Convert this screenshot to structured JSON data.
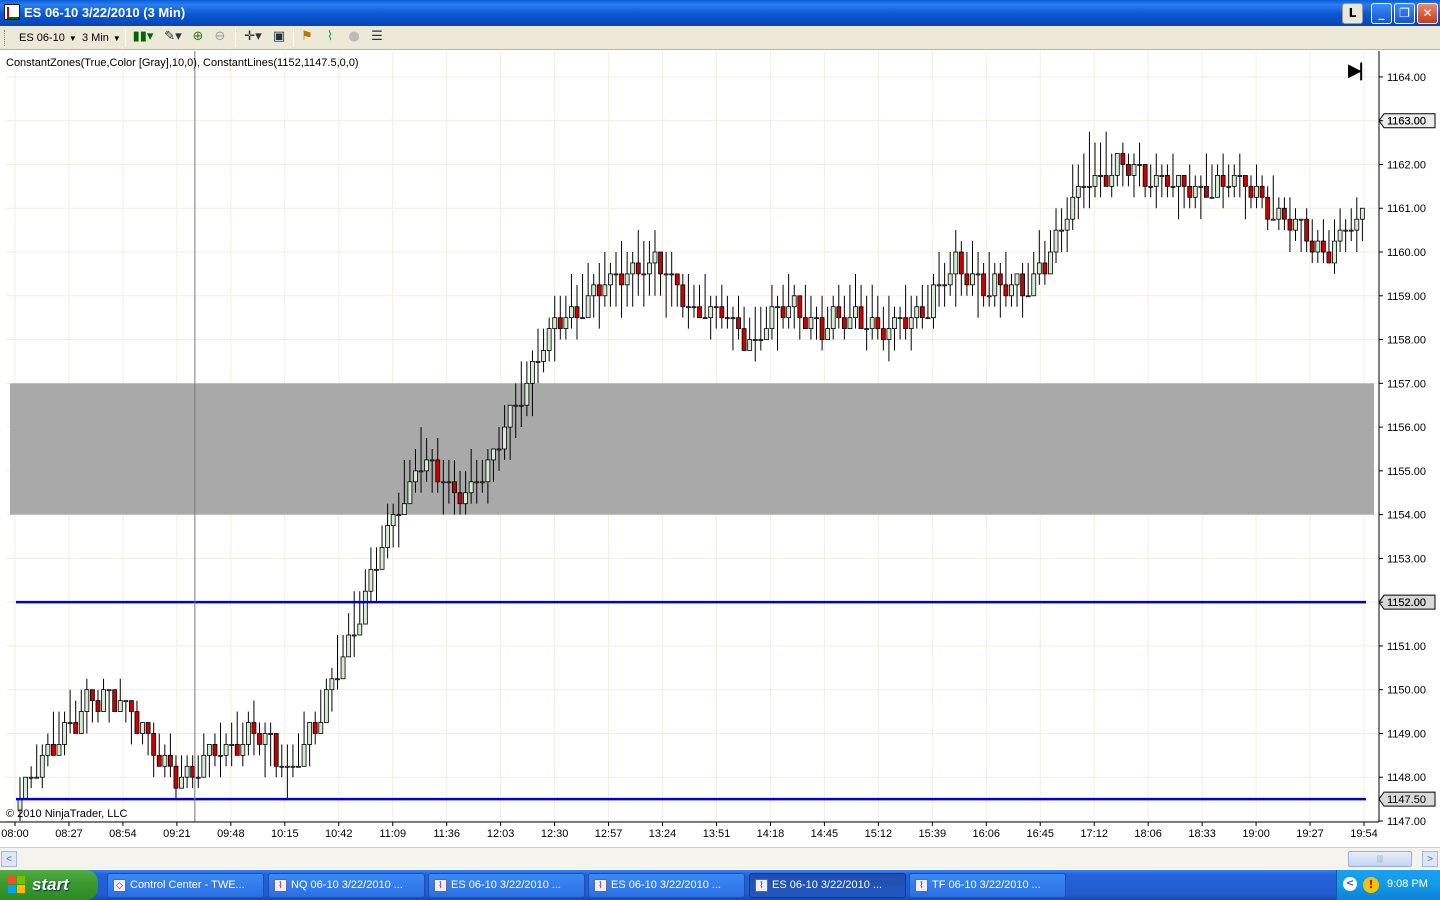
{
  "window": {
    "title": "ES 06-10  3/22/2010 (3 Min)",
    "link_label": "L",
    "minimize_glyph": "_",
    "maximize_glyph": "❐",
    "close_glyph": "✕"
  },
  "toolbar": {
    "instrument": "ES 06-10",
    "interval": "3 Min",
    "icons": [
      "bar-style-icon",
      "drawing-pencil-icon",
      "zoom-in-icon",
      "zoom-out-icon",
      "crosshair-icon",
      "data-box-icon",
      "strategy-icon",
      "indicator-icon",
      "gray-circle-icon",
      "properties-icon"
    ]
  },
  "chart": {
    "indicator_label": "ConstantZones(True,Color [Gray],10,0), ConstantLines(1152,1147.5,0,0)",
    "copyright": "© 2010 NinjaTrader, LLC",
    "play_end_glyph": "▶|"
  },
  "chart_data": {
    "type": "candlestick",
    "instrument": "ES 06-10",
    "interval": "3 Min",
    "date": "3/22/2010",
    "ylim": [
      1147.0,
      1164.25
    ],
    "y_ticks": [
      "1164.00",
      "1163.00",
      "1162.00",
      "1161.00",
      "1160.00",
      "1159.00",
      "1158.00",
      "1157.00",
      "1156.00",
      "1155.00",
      "1154.00",
      "1153.00",
      "1152.00",
      "1151.00",
      "1150.00",
      "1149.00",
      "1148.00",
      "1147.00"
    ],
    "x_ticks": [
      "08:00",
      "08:27",
      "08:54",
      "09:21",
      "09:48",
      "10:15",
      "10:42",
      "11:09",
      "11:36",
      "12:03",
      "12:30",
      "12:57",
      "13:24",
      "13:51",
      "14:18",
      "14:45",
      "15:12",
      "15:39",
      "16:06",
      "16:45",
      "17:12",
      "18:06",
      "18:33",
      "19:00",
      "19:27",
      "19:54"
    ],
    "last_price_label": "1163.00",
    "zone": {
      "from": 1154.0,
      "to": 1157.0,
      "color": "#a9a9a9"
    },
    "constant_lines": [
      {
        "value": 1152.0,
        "label": "1152.00",
        "color": "#0000d0"
      },
      {
        "value": 1147.5,
        "label": "1147.50",
        "color": "#0000d0"
      }
    ],
    "vertical_marker_time": "09:30",
    "up_color": "#d4ecd4",
    "down_color": "#cc0000",
    "anchors": [
      [
        1147.5,
        1147.25,
        1147.75
      ],
      [
        1148.8,
        1148.5,
        1149.25
      ],
      [
        1149.6,
        1149.25,
        1150.0
      ],
      [
        1149.9,
        1149.5,
        1150.0
      ],
      [
        1148.5,
        1148.25,
        1149.0
      ],
      [
        1148.0,
        1147.75,
        1148.25
      ],
      [
        1148.6,
        1148.25,
        1149.0
      ],
      [
        1149.1,
        1148.5,
        1149.5
      ],
      [
        1148.2,
        1147.75,
        1148.5
      ],
      [
        1149.3,
        1149.0,
        1149.75
      ],
      [
        1151.5,
        1151.0,
        1152.0
      ],
      [
        1153.6,
        1153.0,
        1154.0
      ],
      [
        1155.3,
        1154.75,
        1155.75
      ],
      [
        1154.5,
        1154.0,
        1155.0
      ],
      [
        1155.0,
        1154.5,
        1155.25
      ],
      [
        1156.8,
        1156.0,
        1157.25
      ],
      [
        1158.2,
        1157.75,
        1158.75
      ],
      [
        1158.9,
        1158.5,
        1159.5
      ],
      [
        1159.4,
        1158.75,
        1160.0
      ],
      [
        1159.8,
        1159.0,
        1160.25
      ],
      [
        1158.8,
        1158.5,
        1159.25
      ],
      [
        1158.5,
        1158.25,
        1159.0
      ],
      [
        1158.0,
        1157.75,
        1158.5
      ],
      [
        1158.8,
        1158.25,
        1159.25
      ],
      [
        1158.3,
        1158.0,
        1158.75
      ],
      [
        1158.6,
        1158.25,
        1159.25
      ],
      [
        1158.1,
        1157.75,
        1158.75
      ],
      [
        1158.7,
        1158.25,
        1159.0
      ],
      [
        1159.6,
        1159.0,
        1160.25
      ],
      [
        1159.2,
        1158.75,
        1159.75
      ],
      [
        1159.1,
        1158.75,
        1159.5
      ],
      [
        1160.2,
        1159.75,
        1160.75
      ],
      [
        1161.8,
        1161.25,
        1162.5
      ],
      [
        1161.9,
        1161.5,
        1162.25
      ],
      [
        1161.7,
        1161.25,
        1162.0
      ],
      [
        1161.4,
        1161.0,
        1161.75
      ],
      [
        1161.6,
        1161.25,
        1162.0
      ],
      [
        1161.4,
        1161.0,
        1161.75
      ],
      [
        1160.6,
        1160.25,
        1161.0
      ],
      [
        1160.1,
        1159.75,
        1160.5
      ],
      [
        1160.6,
        1160.25,
        1161.0
      ],
      [
        1161.1,
        1160.75,
        1161.5
      ],
      [
        1161.9,
        1161.5,
        1162.25
      ],
      [
        1162.4,
        1162.0,
        1163.0
      ],
      [
        1162.5,
        1162.0,
        1163.0
      ],
      [
        1161.8,
        1161.5,
        1162.5
      ],
      [
        1161.6,
        1161.25,
        1162.25
      ],
      [
        1162.4,
        1162.0,
        1162.75
      ],
      [
        1162.6,
        1162.25,
        1163.25
      ],
      [
        1161.6,
        1161.25,
        1162.25
      ],
      [
        1161.6,
        1161.25,
        1162.25
      ],
      [
        1161.7,
        1161.25,
        1162.5
      ],
      [
        1161.5,
        1161.0,
        1162.0
      ],
      [
        1161.4,
        1160.5,
        1161.75
      ],
      [
        1161.2,
        1160.75,
        1161.75
      ],
      [
        1161.7,
        1161.25,
        1162.0
      ],
      [
        1162.3,
        1162.0,
        1162.75
      ],
      [
        1162.6,
        1162.25,
        1163.0
      ],
      [
        1162.6,
        1162.25,
        1163.0
      ],
      [
        1162.5,
        1162.25,
        1162.75
      ],
      [
        1162.6,
        1162.25,
        1162.75
      ],
      [
        1162.5,
        1162.25,
        1162.75
      ],
      [
        1162.6,
        1162.25,
        1162.75
      ],
      [
        1163.2,
        1162.75,
        1163.75
      ],
      [
        1163.6,
        1163.25,
        1163.9
      ],
      [
        1163.4,
        1163.25,
        1163.5
      ],
      [
        1163.4,
        1163.25,
        1163.5
      ],
      [
        1163.35,
        1163.25,
        1163.5
      ],
      [
        1163.4,
        1163.25,
        1163.5
      ],
      [
        1163.3,
        1163.0,
        1163.5
      ],
      [
        1163.1,
        1162.75,
        1163.25
      ],
      [
        1163.1,
        1162.75,
        1163.25
      ],
      [
        1163.0,
        1162.75,
        1163.25
      ],
      [
        1163.0,
        1162.75,
        1163.25
      ]
    ]
  },
  "statusbar": {
    "scroll_left_glyph": "<",
    "scroll_right_glyph": ">",
    "scroll_thumb_grip": "|||"
  },
  "taskbar": {
    "start_label": "start",
    "tasks": [
      {
        "label": "Control Center - TWE...",
        "active": false
      },
      {
        "label": "NQ 06-10  3/22/2010 ...",
        "active": false
      },
      {
        "label": "ES 06-10  3/22/2010 ...",
        "active": false
      },
      {
        "label": "ES 06-10  3/22/2010 ...",
        "active": false
      },
      {
        "label": "ES 06-10  3/22/2010 ...",
        "active": true
      },
      {
        "label": "TF 06-10  3/22/2010 ...",
        "active": false
      }
    ],
    "clock": "9:08 PM",
    "tray_chevron": "<",
    "tray_icon_glyph": "!"
  }
}
